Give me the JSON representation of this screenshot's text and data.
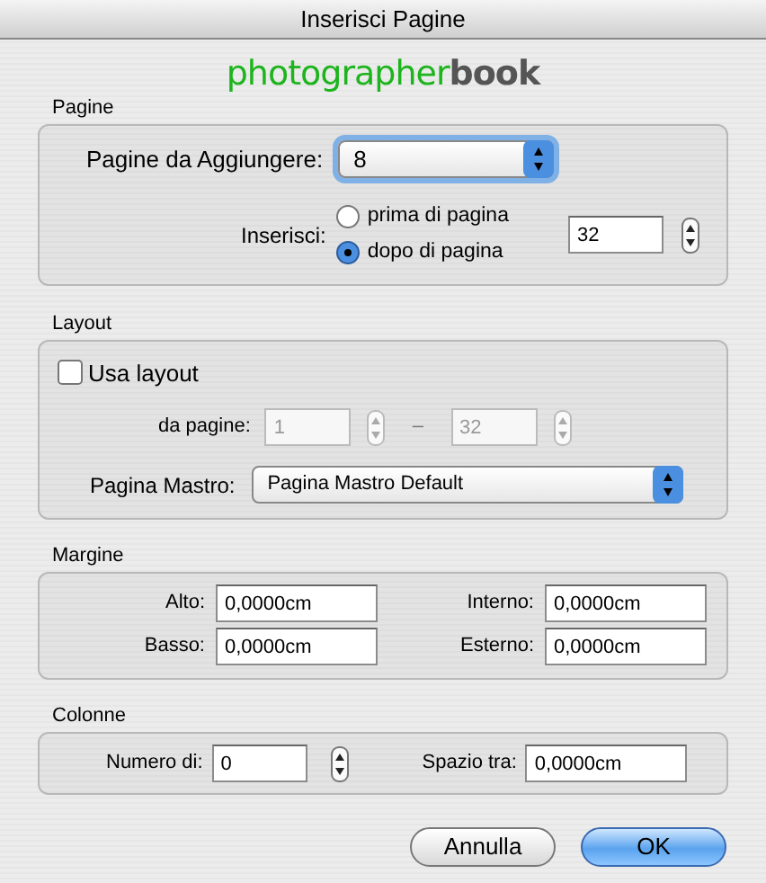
{
  "window": {
    "title": "Inserisci Pagine"
  },
  "logo": {
    "text": "photographer**book**"
  },
  "pagine": {
    "title": "Pagine",
    "pages_to_add": {
      "label": "Pagine da Aggiungere:",
      "value": "8"
    },
    "insert": {
      "label": "Inserisci:",
      "options": [
        {
          "label": "prima di pagina",
          "selected": false
        },
        {
          "label": "dopo di pagina",
          "selected": true
        }
      ],
      "page": "32"
    }
  },
  "layout": {
    "title": "Layout",
    "use_layout": {
      "label": "Usa layout",
      "checked": false
    },
    "from_pages": {
      "label": "da pagine:",
      "from": "1",
      "separator": "–",
      "to": "32",
      "disabled": true
    },
    "master": {
      "label": "Pagina Mastro:",
      "value": "Pagina Mastro Default"
    }
  },
  "margine": {
    "title": "Margine",
    "fields": [
      {
        "label": "Alto:",
        "value": "0,0000cm"
      },
      {
        "label": "Interno:",
        "value": "0,0000cm"
      },
      {
        "label": "Basso:",
        "value": "0,0000cm"
      },
      {
        "label": "Esterno:",
        "value": "0,0000cm"
      }
    ]
  },
  "colonne": {
    "title": "Colonne",
    "number": {
      "label": "Numero di:",
      "value": "0"
    },
    "spacing": {
      "label": "Spazio tra:",
      "value": "0,0000cm"
    }
  },
  "buttons": [
    {
      "label": "Annulla",
      "default": false
    },
    {
      "label": "OK",
      "default": true
    }
  ]
}
